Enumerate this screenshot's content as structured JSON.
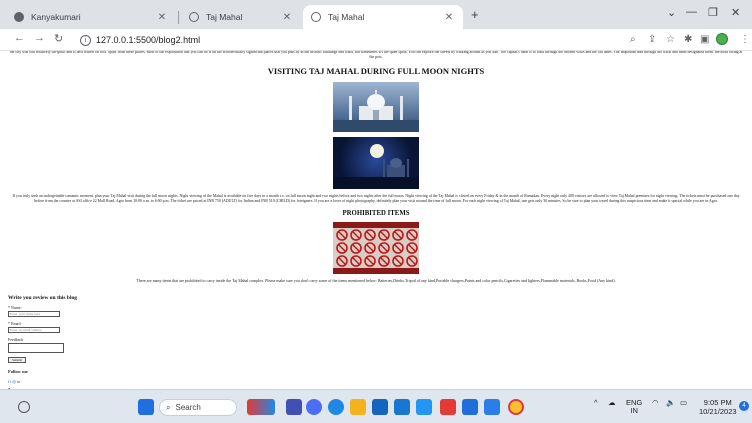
{
  "browser": {
    "tabs": [
      {
        "title": "Kanyakumari",
        "active": false
      },
      {
        "title": "Taj Mahal",
        "active": false
      },
      {
        "title": "Taj Mahal",
        "active": true
      }
    ],
    "new_tab_label": "+",
    "url": "127.0.0.1:5500/blog2.html"
  },
  "page": {
    "intro_tail": "the city was still relatively un-spoilt and is best toured on foot. Apart from these places, most of the exploration that you can do is on the architecturally significant places that you pass by in the historic buildings and walls, but sometimes it's the quiet spots. You can explore the streets by walking around as you like. The capital's ideal is to walk through the ancient walls and the old lanes. The important lead through the walls and finds designated them, the most fitting at the post.",
    "main_heading": "VISITING TAJ MAHAL DURING FULL MOON NIGHTS",
    "moon_paragraph": "If you truly seek an unforgettable romantic moment, plan your Taj Mahal visit during the full moon nights. Night viewing of the Mahal is available on five days in a month i.e. on full moon night and two nights before and two nights after the full moon. Night viewing of the Taj Mahal is closed on every Friday & in the month of Ramadan. Every night only 400 visitors are allowed to view Taj Mahal premises for night viewing. The tickets must be purchased one day before from the counter at ASI office 22 Mall Road, Agra from 10:00 a.m. to 6:00 p.m. The ticket are priced at INR 750 (ADULT) for Indian and INR 510 (CHILD) for foreigners. If you are a lover of night photography, definitely plan your visit around the time of full moon. For each night viewing of Taj Mahal, one gets only 30 minutes. So be sure to plan your travel during this auspicious time and make it special while you are in Agra.",
    "items_heading": "PROHIBITED ITEMS",
    "items_paragraph": "There are many items that are prohibited to carry inside the Taj Mahal complex. Please make sure you don't carry some of the items mentioned below: Batteries,Drinks,Tripod of any kind,Portable chargers,Paints and color pencils,Cigarettes and lighters,Flammable materials, Books,Food (Any kind).",
    "review": {
      "title": "Write you review on this blog",
      "name_label": "* Name:",
      "name_placeholder": "Enter your name here",
      "email_label": "* Email:",
      "email_placeholder": "Enter an email address",
      "feedback_label": "Feedback",
      "submit_label": "Submit",
      "follow_label": "Follow me"
    }
  },
  "taskbar": {
    "search_label": "Search",
    "lang_primary": "ENG",
    "lang_secondary": "IN",
    "time": "9:05 PM",
    "date": "10/21/2023",
    "notification_count": "4"
  },
  "colors": {
    "tab_bar": "#dee1e6",
    "taskbar": "#dfe6ee",
    "link": "#1a4db0"
  }
}
